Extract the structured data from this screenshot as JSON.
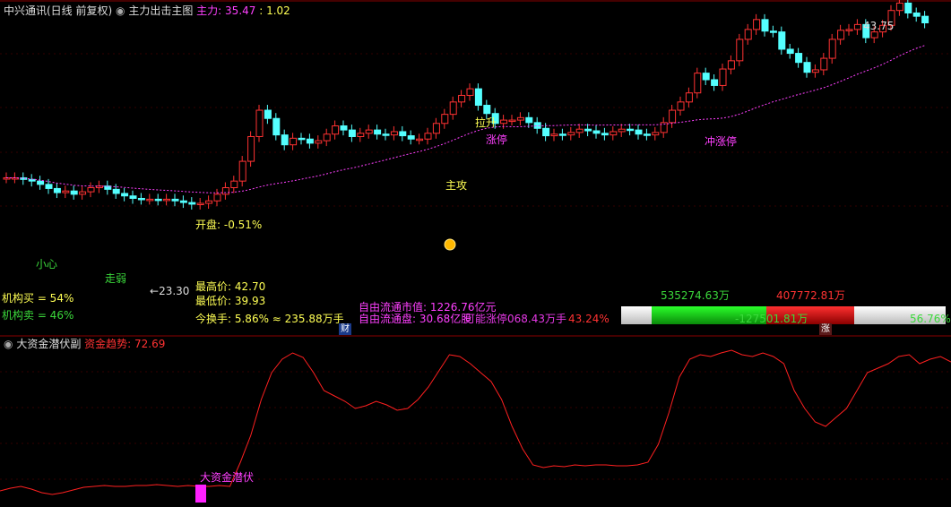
{
  "header": {
    "title": "中兴通讯(日线 前复权)",
    "indicator_name": "主力出击主图",
    "main_label": "主力:",
    "main_value": "35.47",
    "ratio": ": 1.02"
  },
  "main_chart": {
    "max_label": "43.75",
    "min_label": "23.30",
    "annotations": [
      "小心",
      "走弱",
      "主攻",
      "拉升",
      "涨停",
      "冲涨停",
      "开盘: -0.51%"
    ],
    "institutions": {
      "buy_label": "机构买 = 54%",
      "sell_label": "机构卖 = 46%"
    },
    "quote": {
      "high": "最高价: 42.70",
      "low": "最低价: 39.93",
      "turnover": "今换手: 5.86% ≈ 235.88万手",
      "badge": "财"
    },
    "float": {
      "cap": "自由流通市值: 1226.76亿元",
      "shares": "自由流通盘: 30.68亿股",
      "overlap": "可能涨停068.43万手",
      "pct": "43.24%"
    },
    "flow": {
      "green_val": "535274.63万",
      "red_val": "407772.81万",
      "net_val": "-127501.81万",
      "pct": "56.76%",
      "badge": "涨",
      "buy_fraction": 0.5676
    }
  },
  "sub_chart": {
    "title": "大资金潜伏副",
    "trend_label": "资金趋势:",
    "trend_value": "72.69",
    "signal_label": "大资金潜伏"
  },
  "colors": {
    "up": "#ff3232",
    "down": "#54ffff",
    "ma": "#ff40ff",
    "magenta": "#ff40ff",
    "yellow": "#ffff54"
  }
}
